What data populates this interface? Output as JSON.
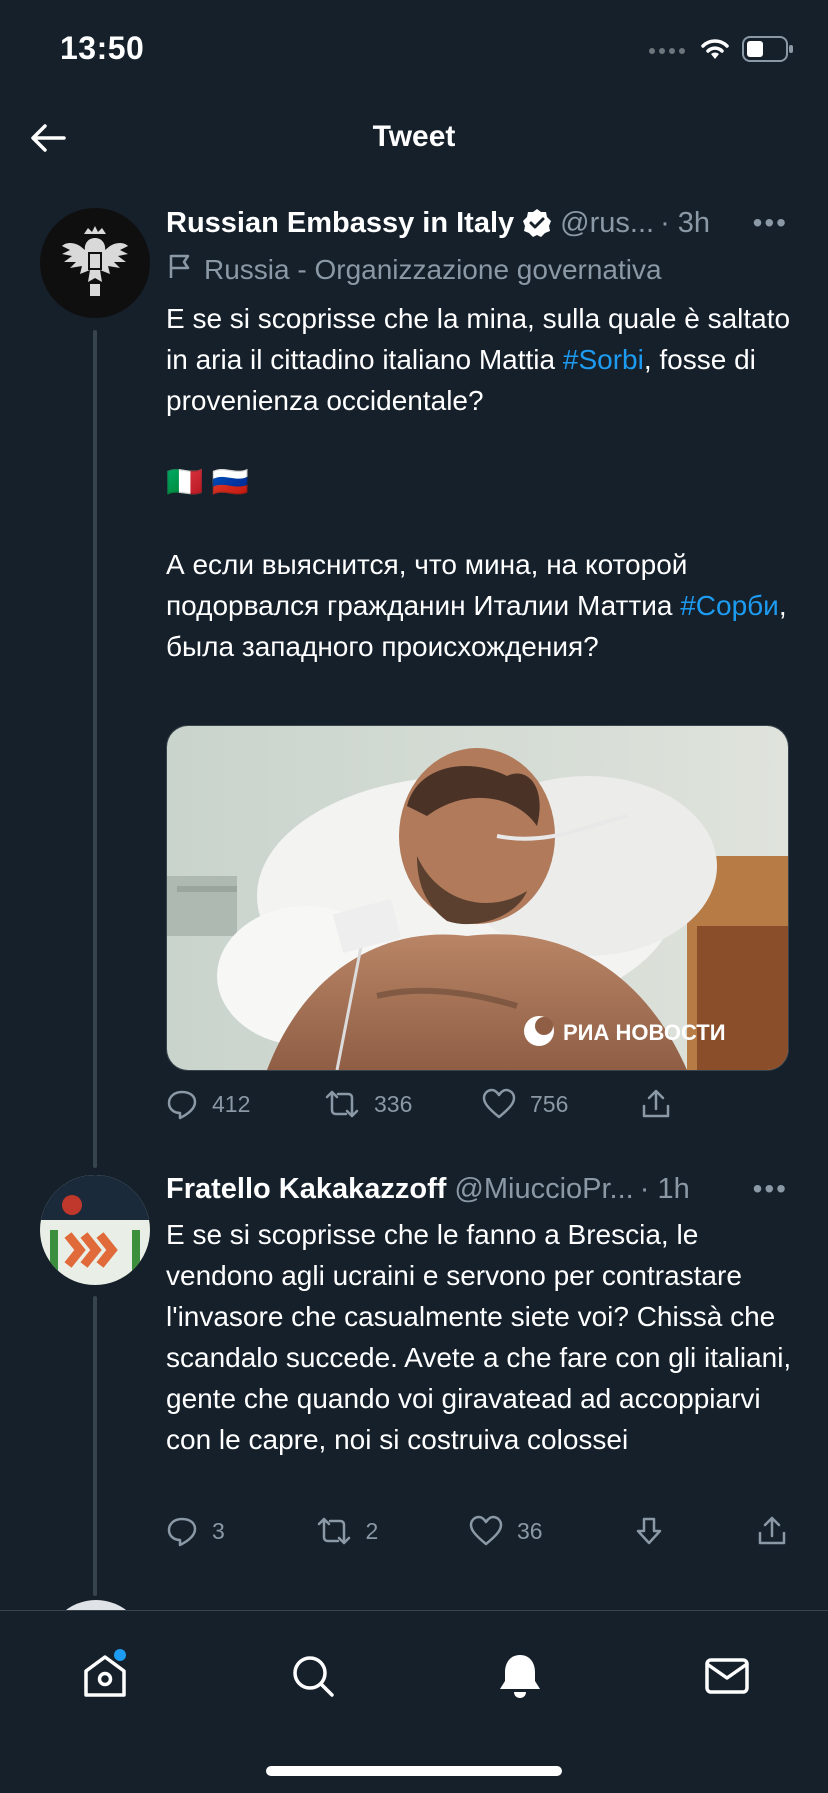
{
  "status_bar": {
    "time": "13:50"
  },
  "header": {
    "title": "Tweet"
  },
  "tweet": {
    "author_name": "Russian Embassy in Italy",
    "handle": "@rus...",
    "time": "· 3h",
    "label": "Russia - Organizzazione governativa",
    "text_p1_before": "E se si scoprisse che la mina, sulla quale è saltato in aria il cittadino italiano Mattia ",
    "hashtag1": "#Sorbi",
    "text_p1_after": ", fosse di provenienza occidentale?",
    "flags": "🇮🇹 🇷🇺",
    "text_p2_before": "А если выяснится, что мина, на которой подорвался гражданин Италии Маттиа ",
    "hashtag2": "#Сорби",
    "text_p2_after": ", была западного происхождения?",
    "media_watermark": "РИА НОВОСТИ",
    "replies": "412",
    "retweets": "336",
    "likes": "756"
  },
  "reply": {
    "author_name": "Fratello Kakakazzoff",
    "handle": "@MiuccioPr...",
    "time": "· 1h",
    "text": "E se si scoprisse che le fanno a Brescia, le vendono agli ucraini e servono per contrastare l'invasore che casualmente siete voi? Chissà che scandalo succede. Avete a che fare con gli italiani, gente che quando voi giravatead ad accoppiarvi con le capre, noi si costruiva colossei",
    "replies": "3",
    "retweets": "2",
    "likes": "36"
  },
  "tabbar": {
    "items": [
      "home",
      "search",
      "notifications",
      "messages"
    ],
    "accent": "#1d9bf0"
  },
  "colors": {
    "background": "#15202b",
    "secondary_text": "#8b98a5",
    "link": "#1d9bf0"
  }
}
